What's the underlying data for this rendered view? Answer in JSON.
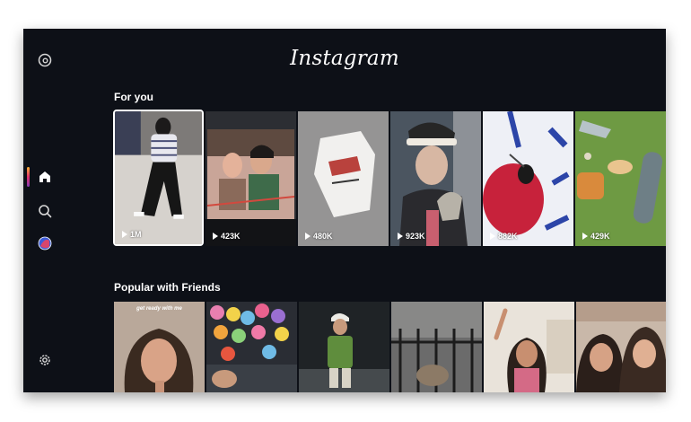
{
  "app": {
    "logo": "Instagram"
  },
  "sidebar": {
    "items": [
      {
        "icon": "threads-icon"
      },
      {
        "icon": "home-icon",
        "active": true
      },
      {
        "icon": "search-icon"
      },
      {
        "icon": "profile-avatar"
      },
      {
        "icon": "settings-icon"
      }
    ]
  },
  "for_you": {
    "title": "For you",
    "tiles": [
      {
        "views": "1M",
        "selected": true
      },
      {
        "views": "423K"
      },
      {
        "views": "480K"
      },
      {
        "views": "923K"
      },
      {
        "views": "882K"
      },
      {
        "views": "429K"
      }
    ]
  },
  "popular": {
    "title": "Popular with Friends",
    "tiles": [
      {
        "caption": "get ready with me"
      },
      {
        "caption": ""
      },
      {
        "caption": ""
      },
      {
        "caption": ""
      },
      {
        "caption": ""
      },
      {
        "caption": ""
      }
    ]
  },
  "colors": {
    "background": "#0d1017",
    "accent_gradient": [
      "#f9b233",
      "#e1306c",
      "#833ab4"
    ]
  }
}
